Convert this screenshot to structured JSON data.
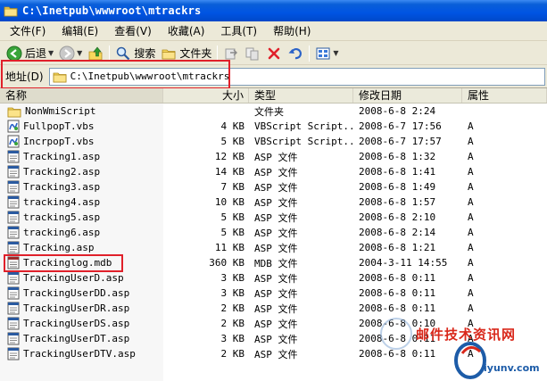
{
  "window": {
    "title": "C:\\Inetpub\\wwwroot\\mtrackrs"
  },
  "menu": [
    {
      "name": "menu-file",
      "label": "文件(F)"
    },
    {
      "name": "menu-edit",
      "label": "编辑(E)"
    },
    {
      "name": "menu-view",
      "label": "查看(V)"
    },
    {
      "name": "menu-favorites",
      "label": "收藏(A)"
    },
    {
      "name": "menu-tools",
      "label": "工具(T)"
    },
    {
      "name": "menu-help",
      "label": "帮助(H)"
    }
  ],
  "toolbar": {
    "back_label": "后退",
    "search_label": "搜索",
    "folders_label": "文件夹"
  },
  "address": {
    "label": "地址(D)",
    "path": "C:\\Inetpub\\wwwroot\\mtrackrs"
  },
  "columns": {
    "name": "名称",
    "size": "大小",
    "type": "类型",
    "date": "修改日期",
    "attr": "属性"
  },
  "files": [
    {
      "icon": "folder-icon",
      "name": "NonWmiScript",
      "size": "",
      "type": "文件夹",
      "date": "2008-6-8 2:24",
      "attr": ""
    },
    {
      "icon": "vbs-script-icon",
      "name": "FullpopT.vbs",
      "size": "4 KB",
      "type": "VBScript Script...",
      "date": "2008-6-7 17:56",
      "attr": "A"
    },
    {
      "icon": "vbs-script-icon",
      "name": "IncrpopT.vbs",
      "size": "5 KB",
      "type": "VBScript Script...",
      "date": "2008-6-7 17:57",
      "attr": "A"
    },
    {
      "icon": "asp-file-icon",
      "name": "Tracking1.asp",
      "size": "12 KB",
      "type": "ASP 文件",
      "date": "2008-6-8 1:32",
      "attr": "A"
    },
    {
      "icon": "asp-file-icon",
      "name": "Tracking2.asp",
      "size": "14 KB",
      "type": "ASP 文件",
      "date": "2008-6-8 1:41",
      "attr": "A"
    },
    {
      "icon": "asp-file-icon",
      "name": "Tracking3.asp",
      "size": "7 KB",
      "type": "ASP 文件",
      "date": "2008-6-8 1:49",
      "attr": "A"
    },
    {
      "icon": "asp-file-icon",
      "name": "tracking4.asp",
      "size": "10 KB",
      "type": "ASP 文件",
      "date": "2008-6-8 1:57",
      "attr": "A"
    },
    {
      "icon": "asp-file-icon",
      "name": "tracking5.asp",
      "size": "5 KB",
      "type": "ASP 文件",
      "date": "2008-6-8 2:10",
      "attr": "A"
    },
    {
      "icon": "asp-file-icon",
      "name": "tracking6.asp",
      "size": "5 KB",
      "type": "ASP 文件",
      "date": "2008-6-8 2:14",
      "attr": "A"
    },
    {
      "icon": "asp-file-icon",
      "name": "Tracking.asp",
      "size": "11 KB",
      "type": "ASP 文件",
      "date": "2008-6-8 1:21",
      "attr": "A"
    },
    {
      "icon": "mdb-file-icon",
      "name": "Trackinglog.mdb",
      "size": "360 KB",
      "type": "MDB 文件",
      "date": "2004-3-11 14:55",
      "attr": "A"
    },
    {
      "icon": "asp-file-icon",
      "name": "TrackingUserD.asp",
      "size": "3 KB",
      "type": "ASP 文件",
      "date": "2008-6-8 0:11",
      "attr": "A"
    },
    {
      "icon": "asp-file-icon",
      "name": "TrackingUserDD.asp",
      "size": "3 KB",
      "type": "ASP 文件",
      "date": "2008-6-8 0:11",
      "attr": "A"
    },
    {
      "icon": "asp-file-icon",
      "name": "TrackingUserDR.asp",
      "size": "2 KB",
      "type": "ASP 文件",
      "date": "2008-6-8 0:11",
      "attr": "A"
    },
    {
      "icon": "asp-file-icon",
      "name": "TrackingUserDS.asp",
      "size": "2 KB",
      "type": "ASP 文件",
      "date": "2008-6-8 0:10",
      "attr": "A"
    },
    {
      "icon": "asp-file-icon",
      "name": "TrackingUserDT.asp",
      "size": "3 KB",
      "type": "ASP 文件",
      "date": "2008-6-8 0:11",
      "attr": "A"
    },
    {
      "icon": "asp-file-icon",
      "name": "TrackingUserDTV.asp",
      "size": "2 KB",
      "type": "ASP 文件",
      "date": "2008-6-8 0:11",
      "attr": "A"
    }
  ],
  "watermark": {
    "line1": "邮件技术资讯网",
    "line2": "iyunv.com"
  },
  "colors": {
    "titlebar": "#0054e3",
    "highlight_box": "#e0202a",
    "watermark_red": "#d9281b",
    "watermark_blue": "#1d5ca8"
  }
}
